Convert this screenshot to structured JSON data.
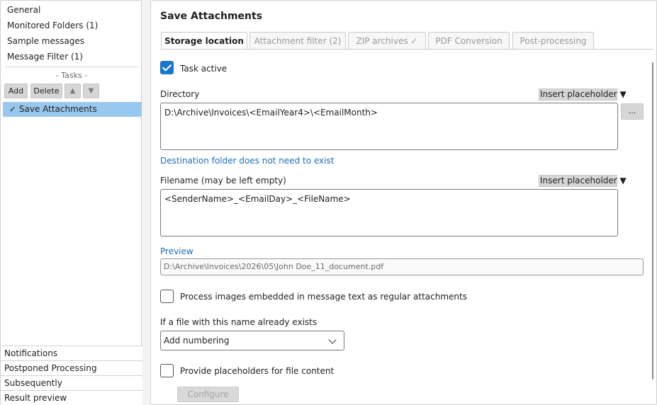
{
  "sidebar": {
    "top_items": [
      "General",
      "Monitored Folders (1)",
      "Sample messages",
      "Message Filter (1)"
    ],
    "tasks_label": "- Tasks -",
    "buttons": {
      "add": "Add",
      "delete": "Delete",
      "up": "▲",
      "down": "▼"
    },
    "selected_task": "✓ Save Attachments",
    "bottom_items": [
      "Notifications",
      "Postponed Processing",
      "Subsequently",
      "Result preview"
    ]
  },
  "main": {
    "title": "Save Attachments",
    "tabs": [
      {
        "label": "Storage location",
        "active": true
      },
      {
        "label": "Attachment filter (2)",
        "active": false
      },
      {
        "label": "ZIP archives ✓",
        "active": false
      },
      {
        "label": "PDF Conversion",
        "active": false
      },
      {
        "label": "Post-processing",
        "active": false
      }
    ],
    "task_active_label": "Task active",
    "directory": {
      "label": "Directory",
      "insert_label": "Insert placeholder ▼",
      "value": "D:\\Archive\\Invoices\\<EmailYear4>\\<EmailMonth>",
      "browse_label": "...",
      "note": "Destination folder does not need to exist"
    },
    "filename": {
      "label": "Filename (may be left empty)",
      "insert_label": "Insert placeholder ▼",
      "value": "<SenderName>_<EmailDay>_<FileName>"
    },
    "preview": {
      "label": "Preview",
      "value": "D:\\Archive\\Invoices\\2026\\05\\John Doe_11_document.pdf"
    },
    "embedded_images_label": "Process images embedded in message text as regular attachments",
    "exists": {
      "label": "If a file with this name already exists",
      "selected": "Add numbering"
    },
    "placeholders_label": "Provide placeholders for file content",
    "configure_label": "Configure"
  },
  "colors": {
    "accent": "#1976c8",
    "selection": "#99c8ee",
    "link": "#1b6fb8"
  }
}
